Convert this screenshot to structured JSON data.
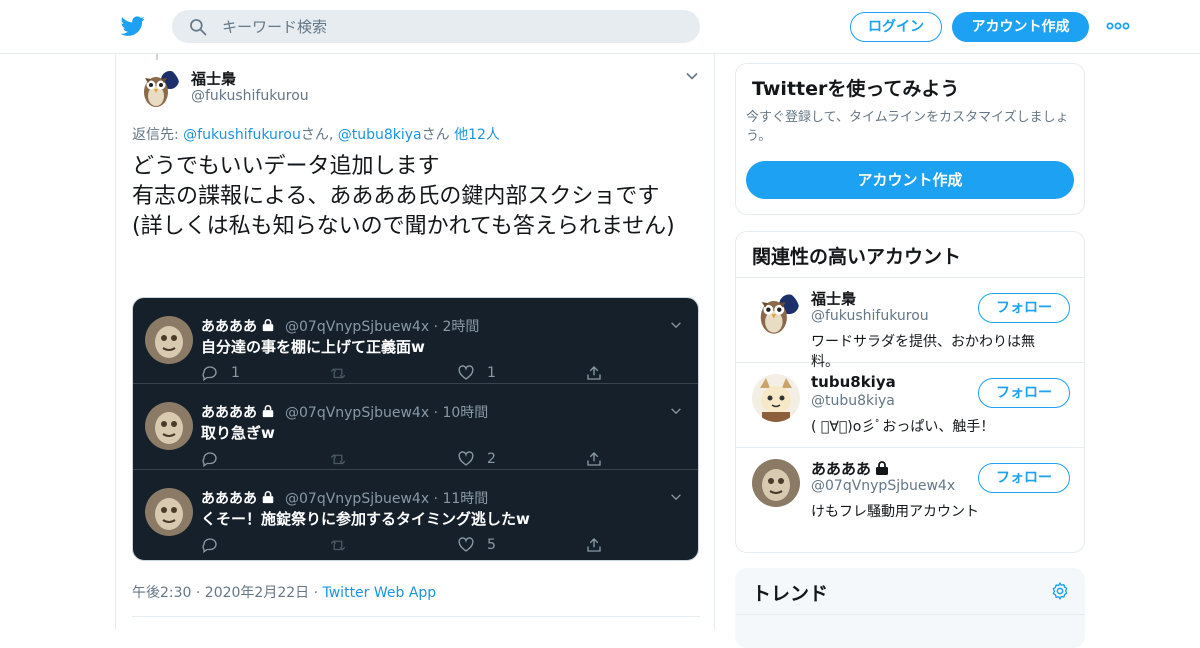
{
  "header": {
    "search_placeholder": "キーワード検索",
    "login_label": "ログイン",
    "signup_label": "アカウント作成",
    "brand_color": "#1da1f2"
  },
  "tweet": {
    "author_name": "福士梟",
    "author_handle": "@fukushifukurou",
    "reply_prefix": "返信先: ",
    "reply_user1": "@fukushifukurou",
    "reply_san1": "さん, ",
    "reply_user2": "@tubu8kiya",
    "reply_san2": "さん ",
    "reply_others": "他12人",
    "text": "どうでもいいデータ追加します\n有志の諜報による、ああああ氏の鍵内部スクショです\n(詳しくは私も知らないので聞かれても答えられません)",
    "time": "午後2:30 · 2020年2月22日 · ",
    "source": "Twitter Web App"
  },
  "screenshot": {
    "tweets": [
      {
        "name": "ああああ",
        "handle": "@07qVnypSjbuew4x · 2時間",
        "text": "自分達の事を棚に上げて正義面w",
        "replies": "1",
        "likes": "1"
      },
      {
        "name": "ああああ",
        "handle": "@07qVnypSjbuew4x · 10時間",
        "text": "取り急ぎw",
        "replies": "",
        "likes": "2"
      },
      {
        "name": "ああああ",
        "handle": "@07qVnypSjbuew4x · 11時間",
        "text": "くそー！施錠祭りに参加するタイミング逃したw",
        "replies": "",
        "likes": "5"
      }
    ]
  },
  "sidebar": {
    "signup_card": {
      "title": "Twitterを使ってみよう",
      "desc": "今すぐ登録して、タイムラインをカスタマイズしましょう。",
      "button": "アカウント作成"
    },
    "related": {
      "title": "関連性の高いアカウント",
      "follow_label": "フォロー",
      "accounts": [
        {
          "name": "福士梟",
          "handle": "@fukushifukurou",
          "bio": "ワードサラダを提供、おかわりは無料。"
        },
        {
          "name": "tubu8kiya",
          "handle": "@tubu8kiya",
          "bio": "( ﾟ∀ﾟ)o彡ﾟおっぱい、触手！"
        },
        {
          "name": "ああああ",
          "handle": "@07qVnypSjbuew4x",
          "bio": "けもフレ騒動用アカウント"
        }
      ]
    },
    "trends": {
      "title": "トレンド"
    }
  },
  "icons": [
    "twitter-logo-icon",
    "search-icon",
    "more-icon",
    "chevron-down-icon",
    "reply-icon",
    "retweet-icon",
    "like-icon",
    "share-icon",
    "lock-icon",
    "gear-icon"
  ]
}
